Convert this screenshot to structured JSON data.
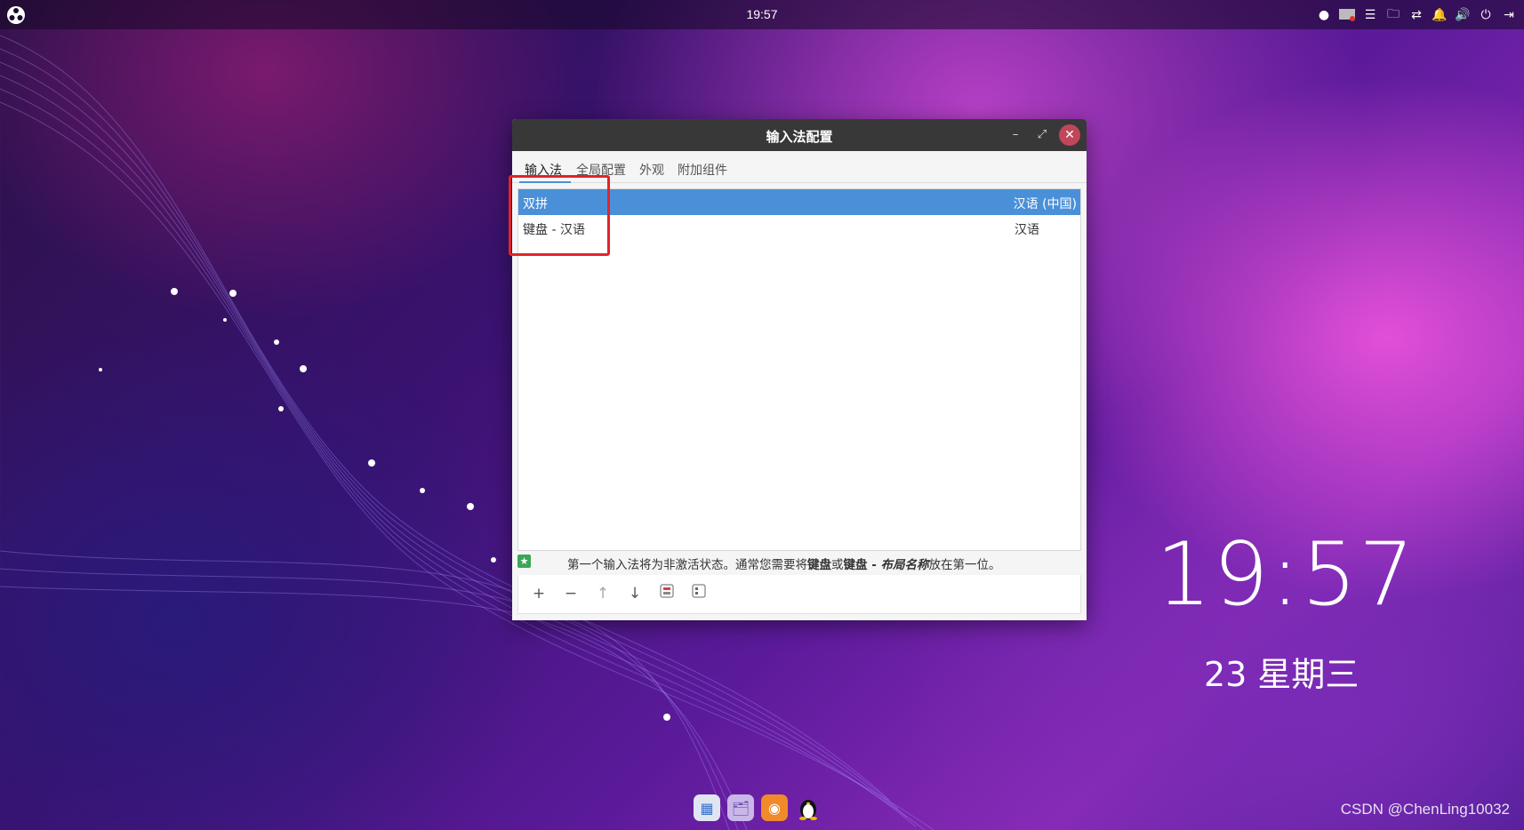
{
  "top_panel": {
    "clock": "19:57"
  },
  "window": {
    "title": "输入法配置",
    "buttons": {
      "minimize": "–",
      "maximize": "⤢",
      "close": "✕"
    },
    "tabs": [
      {
        "label": "输入法",
        "active": true
      },
      {
        "label": "全局配置",
        "active": false
      },
      {
        "label": "外观",
        "active": false
      },
      {
        "label": "附加组件",
        "active": false
      }
    ],
    "input_methods": [
      {
        "name": "双拼",
        "language": "汉语 (中国)",
        "selected": true
      },
      {
        "name": "键盘 - 汉语",
        "language": "汉语",
        "selected": false
      }
    ],
    "hint": {
      "text_before": "第一个输入法将为非激活状态。通常您需要将",
      "bold1": "键盘",
      "middle": "或",
      "bold2": "键盘 - ",
      "bold_italic": "布局名称",
      "text_after": "放在第一位。"
    },
    "toolbar": {
      "add": "+",
      "remove": "−",
      "up": "↑",
      "down": "↓"
    }
  },
  "desktop_clock": {
    "time": "19:57",
    "date": "23 星期三"
  },
  "watermark": "CSDN @ChenLing10032",
  "colors": {
    "selection": "#4a90d9",
    "highlight_box": "#e0242a",
    "titlebar": "#383838",
    "close_button": "#c0475a"
  }
}
